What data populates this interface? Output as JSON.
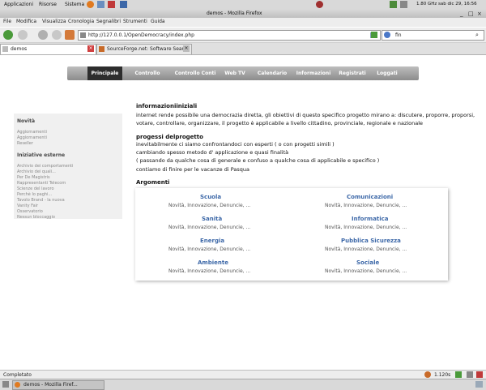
{
  "gnome_panel": {
    "menus": [
      "Applicazioni",
      "Risorse",
      "Sistema"
    ],
    "clock": "1.80 GHz sab dic 29, 16:56"
  },
  "window": {
    "title": "demos - Mozilla Firefox"
  },
  "menubar": [
    "File",
    "Modifica",
    "Visualizza",
    "Cronologia",
    "Segnalibri",
    "Strumenti",
    "Guida"
  ],
  "navbar": {
    "url": "http://127.0.0.1/OpenDemocracy/index.php",
    "search": "fin"
  },
  "tabs": [
    {
      "label": "demos"
    },
    {
      "label": "SourceForge.net: Software Search"
    }
  ],
  "site_nav": [
    "Principale",
    "Controllo Eletti",
    "Controllo Conti",
    "Web TV",
    "Calendario",
    "Informazioni",
    "Registrati",
    "Loggati"
  ],
  "sidebar": {
    "section1": "Novità",
    "section1_items": [
      "Aggiornamenti",
      "Aggiornamenti",
      "Reseller"
    ],
    "section2": "Iniziative esterne",
    "section2_items": [
      "Archivio dei comportamenti",
      "Archivio dei quali...",
      "Per De Magistris",
      "Rappresentanti Telecom",
      "Scienze del lavoro",
      "Perchè lo paghi...",
      "Tavolo Brand - la nuova",
      "Vanity Fair",
      "Osservatorio",
      "Nessun bloccaggio"
    ]
  },
  "main": {
    "h1": "informazioniiniziali",
    "p1_line1": "internet rende possibile una democrazia diretta, gli obiettivi di questo specifico progetto mirano a: discutere, proporre, proporsi,",
    "p1_line2": "votare, controllare, organizzare, il progetto è applicabile a livello cittadino, provinciale, regionale e nazionale",
    "h2": "progessi delprogetto",
    "p2_lines": [
      "inevitabilmente ci siamo confrontandoci con esperti ( o con progetti simili )",
      "cambiando spesso metodo d' applicazione e quasi finalità",
      "( passando da qualche cosa di generale e confuso a qualche cosa di applicabile e specifico )",
      "contiamo di finire per le vacanze di Pasqua"
    ],
    "h3": "Argomenti"
  },
  "topics": [
    {
      "title": "Scuola",
      "subtitle": "Novità, Innovazione, Denuncie, ..."
    },
    {
      "title": "Comunicazioni",
      "subtitle": "Novità, Innovazione, Denuncie, ..."
    },
    {
      "title": "Sanità",
      "subtitle": "Novità, Innovazione, Denuncie, ..."
    },
    {
      "title": "Informatica",
      "subtitle": "Novità, Innovazione, Denuncie, ..."
    },
    {
      "title": "Energia",
      "subtitle": "Novità, Innovazione, Denuncie, ..."
    },
    {
      "title": "Pubblica Sicurezza",
      "subtitle": "Novità, Innovazione, Denuncie, ..."
    },
    {
      "title": "Ambiente",
      "subtitle": "Novità, Innovazione, Denuncie, ..."
    },
    {
      "title": "Sociale",
      "subtitle": "Novità, Innovazione, Denuncie, ..."
    }
  ],
  "statusbar": {
    "text": "Completato",
    "time": "1.120s"
  },
  "taskbar": {
    "item": "demos - Mozilla Firef..."
  },
  "colors": {
    "accent": "#3d68a8",
    "nav_active": "#2d2d2d"
  }
}
